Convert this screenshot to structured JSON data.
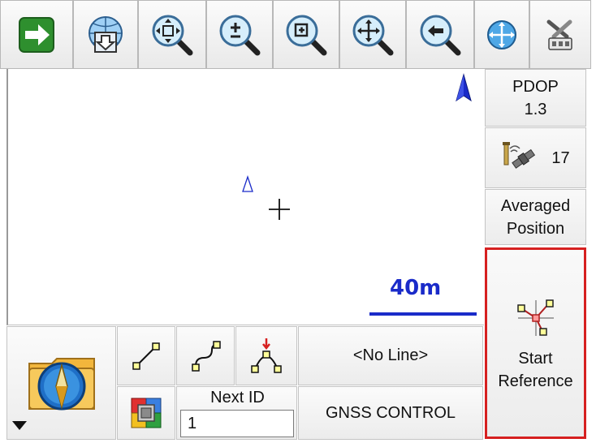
{
  "toolbar": {
    "buttons": [
      {
        "id": "next",
        "icon": "green-right-arrow-icon"
      },
      {
        "id": "download",
        "icon": "globe-down-arrow-icon"
      },
      {
        "id": "zoom-extents",
        "icon": "zoom-extents-icon"
      },
      {
        "id": "zoom-in-out",
        "icon": "zoom-plus-minus-icon"
      },
      {
        "id": "zoom-window",
        "icon": "zoom-window-icon"
      },
      {
        "id": "pan",
        "icon": "zoom-pan-icon"
      },
      {
        "id": "zoom-previous",
        "icon": "zoom-previous-icon"
      },
      {
        "id": "globe-pan",
        "icon": "globe-pan-icon"
      },
      {
        "id": "settings",
        "icon": "tools-icon"
      }
    ]
  },
  "map": {
    "scale_label": "40m",
    "colors": {
      "scale": "#1a2bc9",
      "north": "#1a2bc9"
    }
  },
  "status_panel": {
    "pdop_label": "PDOP",
    "pdop_value": "1.3",
    "satellite_count": "17",
    "averaged_line1": "Averaged",
    "averaged_line2": "Position",
    "start_ref_line1": "Start",
    "start_ref_line2": "Reference",
    "highlight_color": "#d62020"
  },
  "bottom_bar": {
    "line_selector": "<No Line>",
    "next_id_label": "Next ID",
    "next_id_value": "1",
    "control_button": "GNSS CONTROL"
  }
}
